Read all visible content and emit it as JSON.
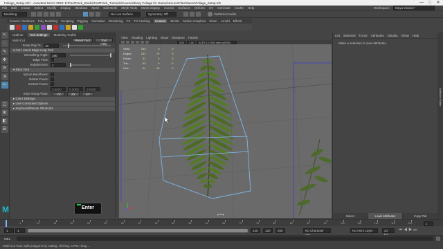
{
  "title_bar": {
    "text": "Foliage_Setup.mb* - Autodesk MAYA 2022: E:\\FastTrack_Studio\\FastTrack_Tutorials\\Courses\\Easy Foliage for Games\\SourceFiles\\Saves\\Foliage_Setup.mb",
    "minimize": "—",
    "maximize": "□",
    "close": "✕"
  },
  "menu_bar": {
    "items": [
      "File",
      "Edit",
      "Create",
      "Select",
      "Modify",
      "Display",
      "Windows",
      "Mesh",
      "Edit Mesh",
      "Mesh Tools",
      "Mesh Display",
      "Curves",
      "Surfaces",
      "Deform",
      "UV",
      "Generate",
      "Cache",
      "Help"
    ],
    "workspace_label": "Workspace:",
    "workspace_value": "Maya Classic*"
  },
  "status_line": {
    "mode": "Modeling",
    "surface_label": "No Live Surface",
    "symmetry_label": "Symmetry: Off",
    "sign_in": "YeahImAnAudio"
  },
  "shelf": {
    "tabs": [
      "Curves / Surfaces",
      "Poly Modeling",
      "Sculpting",
      "Rigging",
      "Animation",
      "Rendering",
      "FX",
      "FX Caching",
      "Custom",
      "MASH",
      "Motion Graphics",
      "XGen",
      "Arnold",
      "Bifrost"
    ],
    "active_tab": "Custom",
    "icon_colors": [
      "#d9d9d9",
      "#c03030",
      "#3070c0",
      "#d0a020",
      "#30a030",
      "#8a50c0",
      "#d9d9d9",
      "#c03030",
      "#3070c0",
      "#d0a020",
      "#e0e0e0",
      "#30a030"
    ]
  },
  "toolbox": {
    "tools": [
      {
        "name": "select-tool-icon",
        "glyph": "↖",
        "active": false
      },
      {
        "name": "lasso-tool-icon",
        "glyph": "◌",
        "active": false
      },
      {
        "name": "paint-select-icon",
        "glyph": "✎",
        "active": false
      },
      {
        "name": "move-tool-icon",
        "glyph": "✥",
        "active": false
      },
      {
        "name": "rotate-tool-icon",
        "glyph": "⟳",
        "active": false
      },
      {
        "name": "scale-tool-icon",
        "glyph": "⇲",
        "active": false
      },
      {
        "name": "multi-cut-icon",
        "glyph": "✂",
        "active": true
      },
      {
        "name": "layout-single-icon",
        "glyph": "▢",
        "active": false
      },
      {
        "name": "layout-four-icon",
        "glyph": "⊞",
        "active": false
      },
      {
        "name": "layout-side-icon",
        "glyph": "◧",
        "active": false
      },
      {
        "name": "outliner-layout-icon",
        "glyph": "☰",
        "active": false
      }
    ]
  },
  "tool_settings": {
    "tabs": [
      "Outliner",
      "Tool Settings",
      "Modeling Toolkit"
    ],
    "active_tab": "Tool Settings",
    "tool_name": "Multi-Cut",
    "reset_button": "Reset Tool",
    "help_button": "Tool Help",
    "snap_step_label": "Snap Step %:",
    "snap_step_value": "10",
    "section_insert_edge": "Cut / Insert Edge Loop Tool",
    "smoothing_angle_label": "Smoothing Angle:",
    "smoothing_angle_value": "180",
    "edge_flow_label": "Edge Flow:",
    "subdivisions_label": "Subdivisions:",
    "subdivisions_value": "1",
    "section_slice": "Slice Tool",
    "ignore_backfaces_label": "Ignore Backfaces:",
    "delete_faces_label": "Delete Faces:",
    "extract_faces_label": "Extract Faces:",
    "extract_values": [
      "0.0000",
      "0.0000",
      "0.0000"
    ],
    "slice_along_label": "Slice Along Plane:",
    "plane_buttons": [
      "YZ",
      "ZX",
      "XY"
    ],
    "section_color": "Color Settings",
    "section_line": "Line Constraint Options",
    "section_keyboard": "Keyboard/Mouse Shortcuts"
  },
  "viewport": {
    "menu": [
      "View",
      "Shading",
      "Lighting",
      "Show",
      "Renderer",
      "Panels"
    ],
    "hud": [
      {
        "label": "Verts:",
        "a": "153",
        "b": "0",
        "c": "0"
      },
      {
        "label": "Edges:",
        "a": "131",
        "b": "73",
        "c": "0"
      },
      {
        "label": "Faces:",
        "a": "31",
        "b": "0",
        "c": "0"
      },
      {
        "label": "Tris:",
        "a": "93",
        "b": "0",
        "c": "0"
      },
      {
        "label": "UVs:",
        "a": "24",
        "b": "16",
        "c": "0"
      }
    ],
    "camera_label": "persp",
    "colorspace": "ACES 1.0 SDR-video (sRGB)",
    "gamma_value": "1.00",
    "exposure_value": "0.00"
  },
  "attribute_editor": {
    "menu": [
      "List",
      "Selected",
      "Focus",
      "Attributes",
      "Display",
      "Show",
      "Help"
    ],
    "hint": "Make a selection to view attributes",
    "bottom_buttons": [
      "Select",
      "Load Attributes",
      "Copy Tab"
    ],
    "side_tab": "Attribute Editor"
  },
  "timeline": {
    "ticks": [
      "5",
      "10",
      "15",
      "20",
      "25",
      "30",
      "35",
      "40",
      "45",
      "50",
      "55",
      "60",
      "65",
      "70",
      "75",
      "80",
      "85",
      "90",
      "95",
      "100",
      "105",
      "110",
      "115",
      "120"
    ],
    "current_frame": "1"
  },
  "range": {
    "start": "1",
    "inner_start": "1",
    "inner_end": "120",
    "end": "120",
    "end2": "200",
    "char_set": "No Character Set",
    "anim_layer": "No Anim Layer",
    "fps": "24 fps"
  },
  "command_line": {
    "lang": "MEL"
  },
  "help_line": {
    "text": "Multi-Cut Tool: Split polygons by cutting; clicking; CTRL+drag ..."
  },
  "overlay": {
    "key_label": "Enter",
    "key_color": "#2ecc40",
    "logo": "M"
  }
}
